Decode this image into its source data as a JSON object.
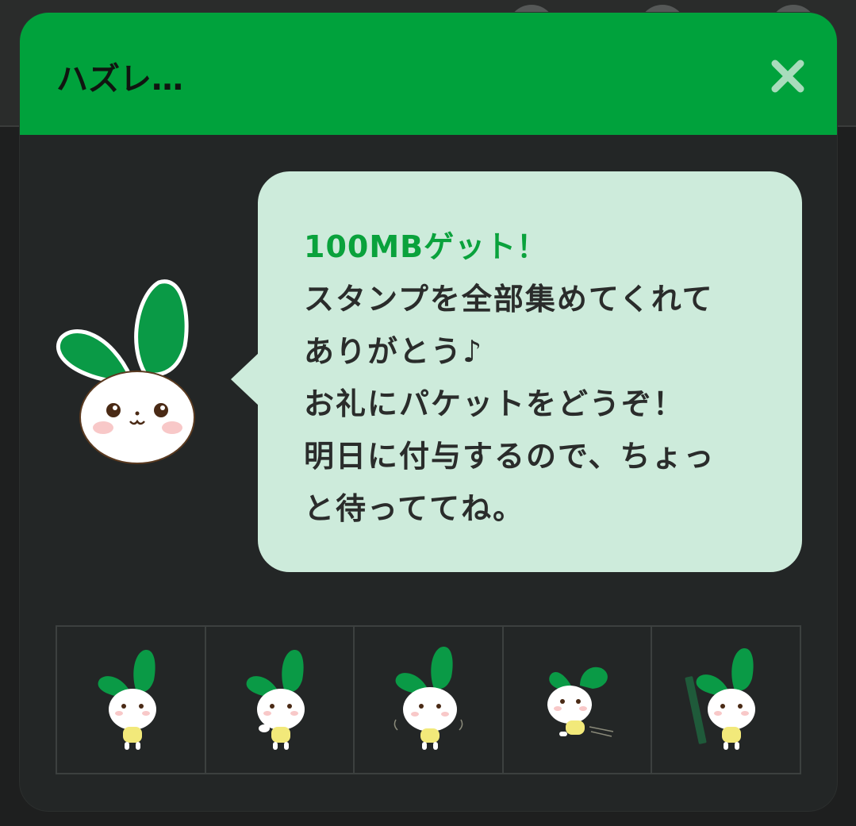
{
  "dialog": {
    "title": "ハズレ…",
    "close_icon": "close-x-icon"
  },
  "message": {
    "highlight": "100MBゲット！",
    "lines": [
      "スタンプを全部集めてくれて",
      "ありがとう♪",
      "お礼にパケットをどうぞ！",
      "明日に付与するので、ちょっ",
      "と待っててね。"
    ]
  },
  "mascot": {
    "icon": "radish-mascot-icon"
  },
  "stamps": [
    {
      "icon": "mascot-standing-stamp"
    },
    {
      "icon": "mascot-waving-stamp"
    },
    {
      "icon": "mascot-arms-out-stamp"
    },
    {
      "icon": "mascot-running-stamp"
    },
    {
      "icon": "mascot-pencil-stamp"
    }
  ],
  "colors": {
    "header_green": "#00a23c",
    "leaf_green": "#0a9a46",
    "bubble_bg": "#cdebdb",
    "dialog_bg": "#232626",
    "close_icon": "#a8dcbc"
  }
}
